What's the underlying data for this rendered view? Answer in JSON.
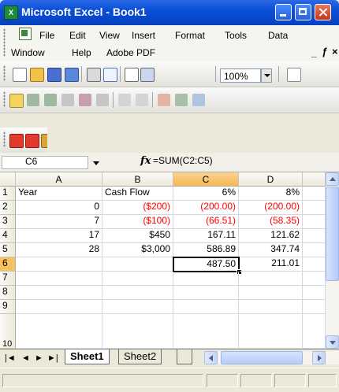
{
  "window": {
    "title": "Microsoft Excel - Book1",
    "app_icon_letter": "X"
  },
  "menu": {
    "row1": [
      "File",
      "Edit",
      "View",
      "Insert",
      "Format",
      "Tools",
      "Data"
    ],
    "row2": [
      "Window",
      "Help",
      "Adobe PDF"
    ],
    "mdi_controls": {
      "minimize": "_",
      "restore": "ƒ",
      "close": "×"
    }
  },
  "toolbar": {
    "zoom": "100%"
  },
  "formula_bar": {
    "name_box": "C6",
    "fx": "fx",
    "formula": "=SUM(C2:C5)"
  },
  "sheet": {
    "columns": [
      "A",
      "B",
      "C",
      "D"
    ],
    "selected_column": "C",
    "rows": [
      "1",
      "2",
      "3",
      "4",
      "5",
      "6",
      "7",
      "8",
      "9",
      "10"
    ],
    "selected_row": "6",
    "cells": {
      "A1": "Year",
      "B1": "Cash Flow",
      "C1": "6%",
      "D1": "8%",
      "A2": "0",
      "B2": "($200)",
      "C2": "(200.00)",
      "D2": "(200.00)",
      "A3": "7",
      "B3": "($100)",
      "C3": "(66.51)",
      "D3": "(58.35)",
      "A4": "17",
      "B4": "$450",
      "C4": "167.11",
      "D4": "121.62",
      "A5": "28",
      "B5": "$3,000",
      "C5": "586.89",
      "D5": "347.74",
      "C6": "487.50",
      "D6": "211.01"
    },
    "negative_color": "#ff0000",
    "active_cell": "C6"
  },
  "tabs": {
    "sheets": [
      "Sheet1",
      "Sheet2"
    ],
    "active": "Sheet1"
  }
}
